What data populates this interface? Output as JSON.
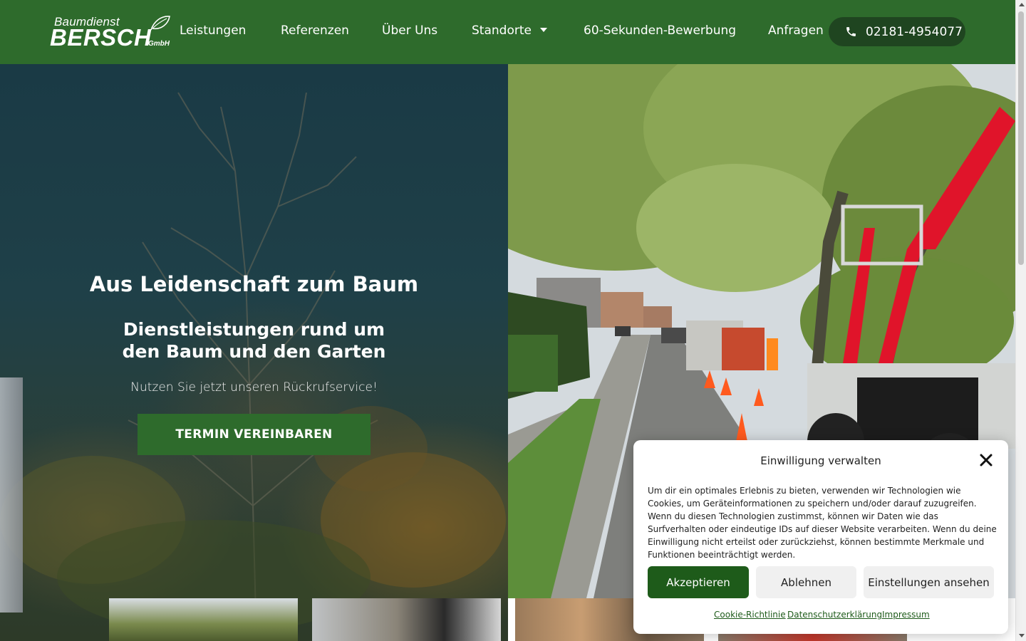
{
  "header": {
    "logo": {
      "line1": "Baumdienst",
      "line2": "BERSCH",
      "line3": "GmbH"
    },
    "nav": [
      {
        "label": "Leistungen"
      },
      {
        "label": "Referenzen"
      },
      {
        "label": "Über Uns"
      },
      {
        "label": "Standorte"
      },
      {
        "label": "60-Sekunden-Bewerbung"
      },
      {
        "label": "Anfragen"
      }
    ],
    "phone": {
      "label": "02181-4954077",
      "icon": "phone-icon"
    },
    "background": "#2e6b2c"
  },
  "hero": {
    "title": "Aus Leidenschaft zum Baum",
    "subtitle": "Dienstleistungen rund um den Baum und den Garten",
    "callback_text": "Nutzen Sie jetzt unseren Rückrufservice!",
    "button_label": "TERMIN VEREINBAREN"
  },
  "cookie_modal": {
    "title": "Einwilligung verwalten",
    "text": "Um dir ein optimales Erlebnis zu bieten, verwenden wir Technologien wie Cookies, um Geräteinformationen zu speichern und/oder darauf zuzugreifen. Wenn du diesen Technologien zustimmst, können wir Daten wie das Surfverhalten oder eindeutige IDs auf dieser Website verarbeiten. Wenn du deine Einwilligung nicht erteilst oder zurückziehst, können bestimmte Merkmale und Funktionen beeinträchtigt werden.",
    "accept": "Akzeptieren",
    "decline": "Ablehnen",
    "settings": "Einstellungen ansehen",
    "links": [
      "Cookie-Richtlinie",
      "Datenschutzerklärung",
      "Impressum"
    ],
    "accent": "#1e5b1a"
  }
}
